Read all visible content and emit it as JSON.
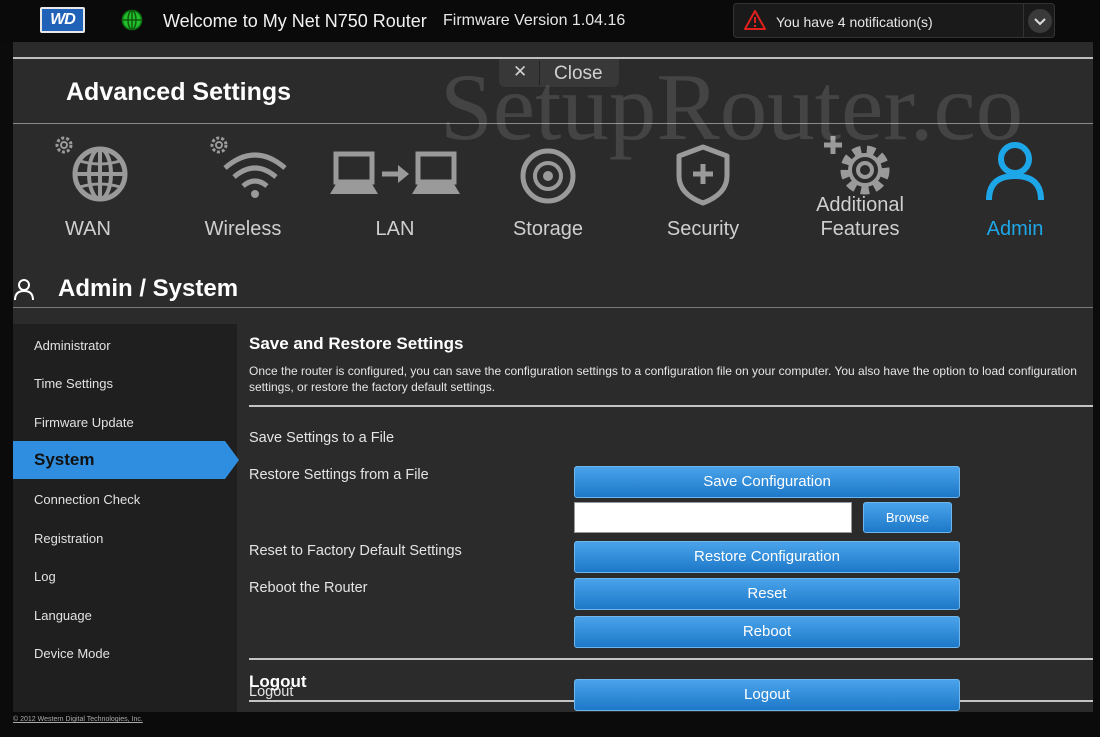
{
  "topbar": {
    "logo_text": "WD",
    "welcome": "Welcome to My Net N750 Router",
    "firmware": "Firmware Version 1.04.16",
    "notification": "You have 4 notification(s)"
  },
  "panel": {
    "close_label": "Close",
    "title": "Advanced Settings",
    "categories": [
      {
        "label": "WAN",
        "icon": "globe-gear-icon"
      },
      {
        "label": "Wireless",
        "icon": "wifi-gear-icon"
      },
      {
        "label": "LAN",
        "icon": "laptop-network-icon"
      },
      {
        "label": "Storage",
        "icon": "disc-icon"
      },
      {
        "label": "Security",
        "icon": "shield-icon"
      },
      {
        "label_1": "Additional",
        "label_2": "Features",
        "icon": "gear-plus-icon"
      },
      {
        "label": "Admin",
        "icon": "user-icon",
        "active": true
      }
    ],
    "section_title": "Admin / System"
  },
  "sidebar": {
    "items": [
      {
        "label": "Administrator"
      },
      {
        "label": "Time Settings"
      },
      {
        "label": "Firmware Update"
      },
      {
        "label": "System"
      },
      {
        "label": "Connection Check"
      },
      {
        "label": "Registration"
      },
      {
        "label": "Log"
      },
      {
        "label": "Language"
      },
      {
        "label": "Device Mode"
      }
    ],
    "active": "System"
  },
  "content": {
    "save_restore_heading": "Save and Restore Settings",
    "save_restore_desc": "Once the router is configured, you can save the configuration settings to a configuration file on your computer. You also have the option to load configuration settings, or restore the factory default settings.",
    "save_label": "Save Settings to a File",
    "save_button": "Save Configuration",
    "restore_label": "Restore Settings from a File",
    "file_value": "",
    "browse_button": "Browse",
    "restore_button": "Restore Configuration",
    "reset_label": "Reset to Factory Default Settings",
    "reset_button": "Reset",
    "reboot_label": "Reboot the Router",
    "reboot_button": "Reboot",
    "logout_heading": "Logout",
    "logout_label": "Logout",
    "logout_button": "Logout"
  },
  "footer": {
    "copyright": "© 2012 Western Digital Technologies, Inc."
  },
  "watermark": "SetupRouter.co",
  "colors": {
    "accent": "#1ea7e8",
    "button": "#2f8ee0",
    "background": "#2b2b2b"
  }
}
